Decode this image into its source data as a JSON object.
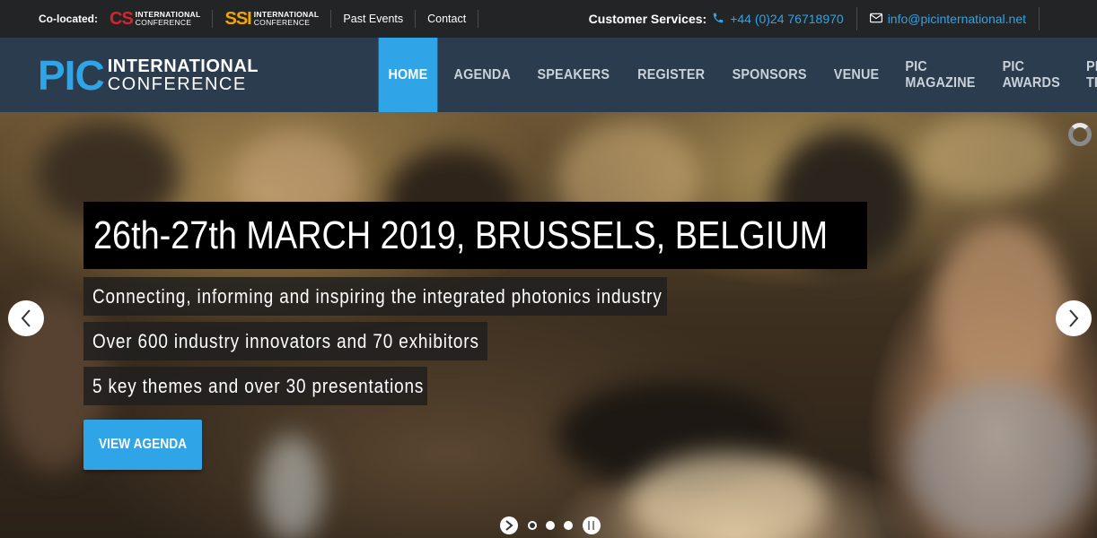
{
  "topbar": {
    "colocated_label": "Co-located:",
    "cs_logo": {
      "abbr": "CS",
      "line1": "INTERNATIONAL",
      "line2": "CONFERENCE"
    },
    "ssi_logo": {
      "abbr": "SSI",
      "line1": "INTERNATIONAL",
      "line2": "CONFERENCE"
    },
    "links": [
      "Past Events",
      "Contact"
    ],
    "customer_services_label": "Customer Services:",
    "phone": "+44 (0)24 76718970",
    "email": "info@picinternational.net"
  },
  "nav": {
    "brand": {
      "abbr": "PIC",
      "line1": "INTERNATIONAL",
      "line2": "CONFERENCE"
    },
    "items": [
      "HOME",
      "AGENDA",
      "SPEAKERS",
      "REGISTER",
      "SPONSORS",
      "VENUE",
      "PIC MAGAZINE",
      "PIC AWARDS",
      "PIC TRAINING"
    ],
    "active": "HOME"
  },
  "hero": {
    "headline": "26th-27th MARCH 2019, BRUSSELS, BELGIUM",
    "lines": [
      "Connecting, informing and inspiring the integrated photonics industry",
      "Over 600 industry innovators and 70 exhibitors",
      "5 key themes and over 30 presentations"
    ],
    "cta_label": "VIEW AGENDA",
    "slide_count": 3,
    "active_slide": 1
  },
  "colors": {
    "accent": "#2fa4e7",
    "topbar_bg": "#222426",
    "navbar_bg": "#2a3c4e",
    "cs_red": "#d5242b",
    "ssi_orange": "#f0a500"
  },
  "icons": {
    "phone": "phone-icon",
    "mail": "mail-icon",
    "prev": "chevron-left-icon",
    "next": "chevron-right-icon",
    "play": "play-icon",
    "pause": "pause-icon",
    "loader": "loading-spinner-icon"
  }
}
